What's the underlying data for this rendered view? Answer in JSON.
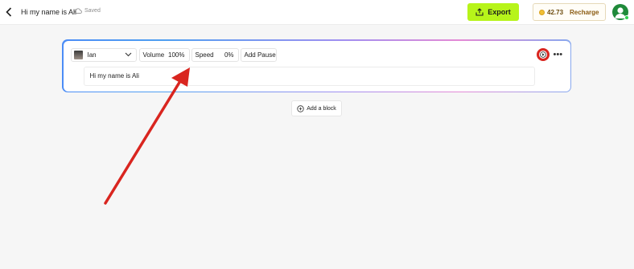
{
  "header": {
    "title": "Hi my name is Ali",
    "saved_label": "Saved",
    "export_label": "Export",
    "credits": "42.73",
    "recharge_label": "Recharge"
  },
  "block": {
    "voice_name": "Ian",
    "volume_label": "Volume",
    "volume_value": "100%",
    "speed_label": "Speed",
    "speed_value": "0%",
    "add_pause_label": "Add Pause",
    "text": "Hi my name is Ali"
  },
  "add_block_label": "Add a block",
  "colors": {
    "accent": "#b7f41a",
    "annotation": "#d9251f",
    "avatar": "#1f8a3a"
  }
}
